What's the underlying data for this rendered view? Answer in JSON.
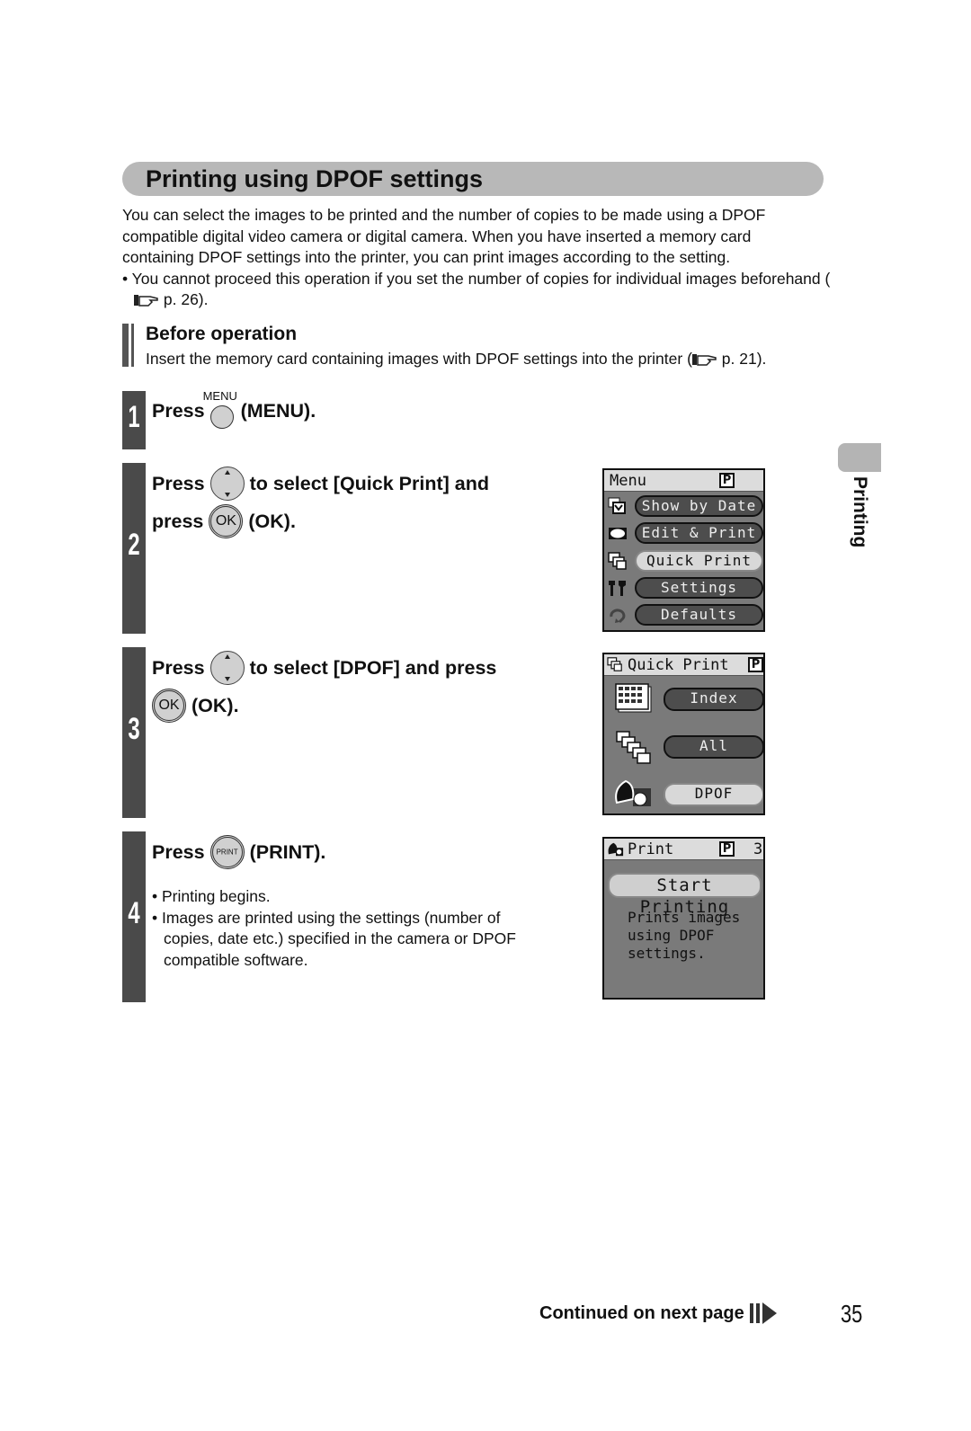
{
  "title": "Printing using DPOF settings",
  "intro": {
    "lines": [
      "You can select the images to be printed and the number of copies to be made using a DPOF",
      "compatible digital video camera or digital camera. When you have inserted a memory card",
      "containing DPOF settings into the printer, you can print images according to the setting."
    ],
    "bullet_prefix": "• You cannot proceed this operation if you set the number of copies for individual images beforehand (",
    "bullet_ref": "p. 26)."
  },
  "before_operation": {
    "heading": "Before operation",
    "text": "Insert the memory card containing images with DPOF settings into the printer (",
    "ref": "p. 21)."
  },
  "steps": [
    {
      "number": "1",
      "press": "Press",
      "button_label": "MENU",
      "suffix": "(MENU)."
    },
    {
      "number": "2",
      "press": "Press",
      "middle": "to select [Quick Print] and",
      "line2_press": "press",
      "ok_label": "OK",
      "suffix": "(OK)."
    },
    {
      "number": "3",
      "press": "Press",
      "middle": "to select [DPOF] and press",
      "ok_label": "OK",
      "suffix": "(OK)."
    },
    {
      "number": "4",
      "press": "Press",
      "button_label": "PRINT",
      "suffix": "(PRINT).",
      "notes": [
        "• Printing begins.",
        "• Images are printed using the settings (number of copies, date etc.) specified in the camera or DPOF compatible software."
      ]
    }
  ],
  "screens": {
    "menu": {
      "title": "Menu",
      "p_mark": "P",
      "items": [
        "Show by Date",
        "Edit & Print",
        "Quick Print",
        "Settings",
        "Defaults"
      ],
      "selected_index": 2
    },
    "quick_print": {
      "title": "Quick Print",
      "p_mark": "P",
      "items": [
        "Index",
        "All",
        "DPOF"
      ],
      "selected_index": 2
    },
    "print": {
      "title": "Print",
      "p_mark": "P",
      "count": "3",
      "button": "Start Printing",
      "desc_lines": [
        "Prints images",
        "using DPOF",
        "settings."
      ]
    }
  },
  "side_tab": "Printing",
  "footer": {
    "continued": "Continued on next page",
    "page_number": "35"
  }
}
